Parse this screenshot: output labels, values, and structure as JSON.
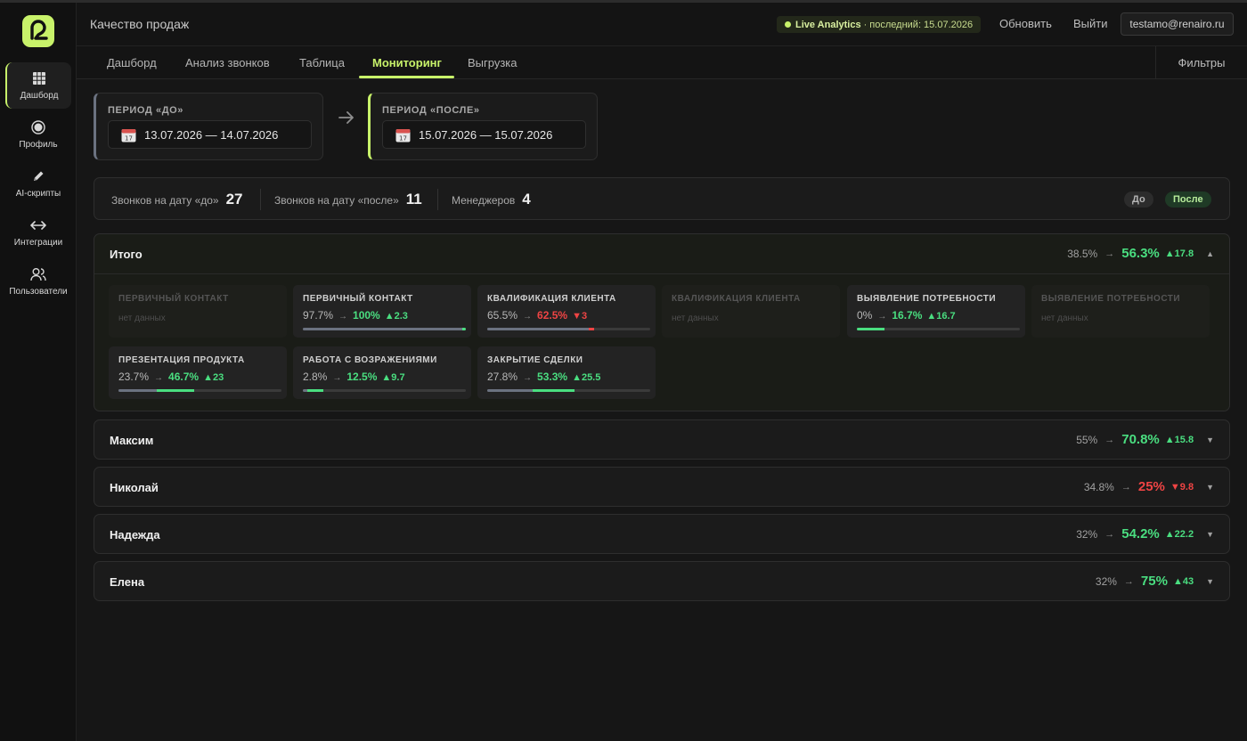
{
  "colors": {
    "accent": "#c8f26a",
    "up": "#4ade80",
    "down": "#ef4444",
    "neutral_bar": "#6b7280"
  },
  "sidebar": {
    "logo_icon": "logo-icon",
    "items": [
      {
        "label": "Дашборд",
        "icon": "grid-icon",
        "active": true
      },
      {
        "label": "Профиль",
        "icon": "profile-icon"
      },
      {
        "label": "AI-скрипты",
        "icon": "pencil-icon"
      },
      {
        "label": "Интеграции",
        "icon": "arrows-icon"
      },
      {
        "label": "Пользователи",
        "icon": "users-icon"
      }
    ]
  },
  "header": {
    "title": "Качество продаж",
    "live": {
      "name": "Live Analytics",
      "rest": "· последний: 15.07.2026"
    },
    "refresh": "Обновить",
    "logout": "Выйти",
    "user_email": "testamo@renairo.ru"
  },
  "tabs": {
    "items": [
      "Дашборд",
      "Анализ звонков",
      "Таблица",
      "Мониторинг",
      "Выгрузка"
    ],
    "active": "Мониторинг",
    "filters": "Фильтры"
  },
  "periods": {
    "before": {
      "label": "ПЕРИОД «ДО»",
      "value": "13.07.2026 — 14.07.2026"
    },
    "after": {
      "label": "ПЕРИОД «ПОСЛЕ»",
      "value": "15.07.2026 — 15.07.2026"
    }
  },
  "stats": {
    "calls_before": {
      "label": "Звонков на дату «до»",
      "value": "27"
    },
    "calls_after": {
      "label": "Звонков на дату «после»",
      "value": "11"
    },
    "managers": {
      "label": "Менеджеров",
      "value": "4"
    },
    "legend_before": "До",
    "legend_after": "После"
  },
  "summary": {
    "name": "Итого",
    "before": "38.5%",
    "after": "56.3%",
    "delta": "▲17.8",
    "trend": "up",
    "chevron": "▲",
    "cards": [
      {
        "title": "ПЕРВИЧНЫЙ КОНТАКТ",
        "nodata": "нет данных"
      },
      {
        "title": "ПЕРВИЧНЫЙ КОНТАКТ",
        "before": "97.7%",
        "after": "100%",
        "delta": "▲2.3",
        "trend": "up",
        "b": 97.7,
        "a": 100
      },
      {
        "title": "КВАЛИФИКАЦИЯ КЛИЕНТА",
        "before": "65.5%",
        "after": "62.5%",
        "delta": "▼3",
        "trend": "down",
        "b": 65.5,
        "a": 62.5
      },
      {
        "title": "КВАЛИФИКАЦИЯ КЛИЕНТА",
        "nodata": "нет данных"
      },
      {
        "title": "ВЫЯВЛЕНИЕ ПОТРЕБНОСТИ",
        "before": "0%",
        "after": "16.7%",
        "delta": "▲16.7",
        "trend": "up",
        "b": 0,
        "a": 16.7
      },
      {
        "title": "ВЫЯВЛЕНИЕ ПОТРЕБНОСТИ",
        "nodata": "нет данных"
      },
      {
        "title": "ПРЕЗЕНТАЦИЯ ПРОДУКТА",
        "before": "23.7%",
        "after": "46.7%",
        "delta": "▲23",
        "trend": "up",
        "b": 23.7,
        "a": 46.7
      },
      {
        "title": "РАБОТА С ВОЗРАЖЕНИЯМИ",
        "before": "2.8%",
        "after": "12.5%",
        "delta": "▲9.7",
        "trend": "up",
        "b": 2.8,
        "a": 12.5
      },
      {
        "title": "ЗАКРЫТИЕ СДЕЛКИ",
        "before": "27.8%",
        "after": "53.3%",
        "delta": "▲25.5",
        "trend": "up",
        "b": 27.8,
        "a": 53.3
      }
    ]
  },
  "managers": [
    {
      "name": "Максим",
      "before": "55%",
      "after": "70.8%",
      "delta": "▲15.8",
      "trend": "up",
      "chevron": "▼"
    },
    {
      "name": "Николай",
      "before": "34.8%",
      "after": "25%",
      "delta": "▼9.8",
      "trend": "down",
      "chevron": "▼"
    },
    {
      "name": "Надежда",
      "before": "32%",
      "after": "54.2%",
      "delta": "▲22.2",
      "trend": "up",
      "chevron": "▼"
    },
    {
      "name": "Елена",
      "before": "32%",
      "after": "75%",
      "delta": "▲43",
      "trend": "up",
      "chevron": "▼"
    }
  ],
  "arrow_glyph": "→"
}
